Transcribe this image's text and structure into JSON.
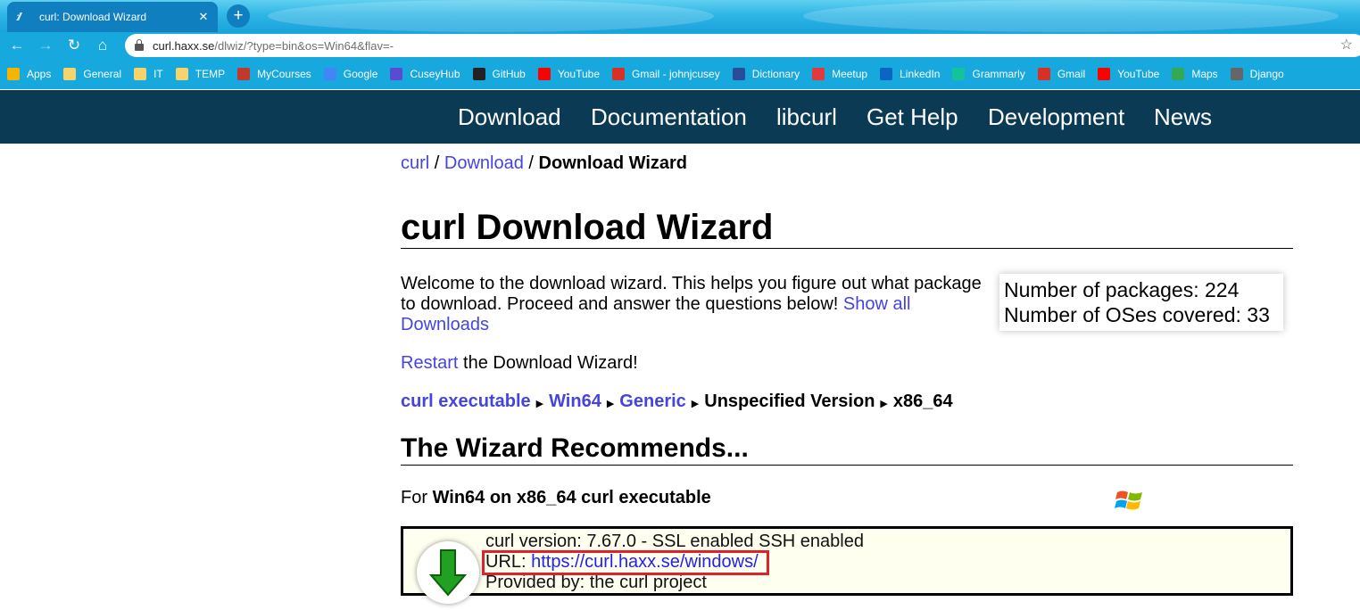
{
  "browser": {
    "tab_title": "curl: Download Wizard",
    "tab_close": "✕",
    "new_tab": "+",
    "address_host": "curl.haxx.se",
    "address_path": "/dlwiz/?type=bin&os=Win64&flav=-",
    "nav": {
      "back": "←",
      "forward": "→",
      "reload": "↻",
      "home": "⌂",
      "star": "☆"
    },
    "bookmarks": [
      {
        "label": "Apps",
        "icon": "apps-grid-icon",
        "color": "#f4b400"
      },
      {
        "label": "General",
        "icon": "folder-icon",
        "color": "#f7d36b"
      },
      {
        "label": "IT",
        "icon": "folder-icon",
        "color": "#f7d36b"
      },
      {
        "label": "TEMP",
        "icon": "folder-icon",
        "color": "#f7d36b"
      },
      {
        "label": "MyCourses",
        "icon": "mycourses-icon",
        "color": "#c0392b"
      },
      {
        "label": "Google",
        "icon": "google-icon",
        "color": "#4285f4"
      },
      {
        "label": "CuseyHub",
        "icon": "cuseyhub-icon",
        "color": "#5b4bd1"
      },
      {
        "label": "GitHub",
        "icon": "github-icon",
        "color": "#222222"
      },
      {
        "label": "YouTube",
        "icon": "youtube-icon",
        "color": "#ff0000"
      },
      {
        "label": "Gmail - johnjcusey",
        "icon": "gmail-icon",
        "color": "#d93025"
      },
      {
        "label": "Dictionary",
        "icon": "dictionary-icon",
        "color": "#2a4d9b"
      },
      {
        "label": "Meetup",
        "icon": "meetup-icon",
        "color": "#e0393e"
      },
      {
        "label": "LinkedIn",
        "icon": "linkedin-icon",
        "color": "#0a66c2"
      },
      {
        "label": "Grammarly",
        "icon": "grammarly-icon",
        "color": "#15c39a"
      },
      {
        "label": "Gmail",
        "icon": "gmail-icon",
        "color": "#d93025"
      },
      {
        "label": "YouTube",
        "icon": "youtube-icon",
        "color": "#ff0000"
      },
      {
        "label": "Maps",
        "icon": "maps-icon",
        "color": "#34a853"
      },
      {
        "label": "Django",
        "icon": "globe-icon",
        "color": "#666666"
      }
    ]
  },
  "site_nav": [
    "Download",
    "Documentation",
    "libcurl",
    "Get Help",
    "Development",
    "News"
  ],
  "breadcrumb": {
    "root": "curl",
    "sep1": " / ",
    "download": "Download",
    "sep2": " / ",
    "current": "Download Wizard"
  },
  "page_title": "curl Download Wizard",
  "intro": {
    "text": "Welcome to the download wizard. This helps you figure out what package to download. Proceed and answer the questions below! ",
    "show_all": "Show all Downloads"
  },
  "stats": {
    "packages": "Number of packages: 224",
    "oses": "Number of OSes covered: 33"
  },
  "restart": {
    "link": "Restart",
    "rest": " the Download Wizard!"
  },
  "steps": {
    "s1": "curl executable",
    "s2": "Win64",
    "s3": "Generic",
    "s4": "Unspecified Version",
    "s5": "x86_64",
    "arrow": "▶"
  },
  "recommends_title": "The Wizard Recommends...",
  "for_line": {
    "prefix": "For ",
    "bold": "Win64 on x86_64 curl executable"
  },
  "recommendation": {
    "version": "curl version: 7.67.0 - SSL enabled SSH enabled",
    "url_label": "URL: ",
    "url": "https://curl.haxx.se/windows/",
    "provider": "Provided by: the curl project"
  },
  "colors": {
    "nav_bg": "#0b3a55",
    "link": "#4444e0",
    "highlight": "#e0202a",
    "box_bg": "#fffff0"
  }
}
